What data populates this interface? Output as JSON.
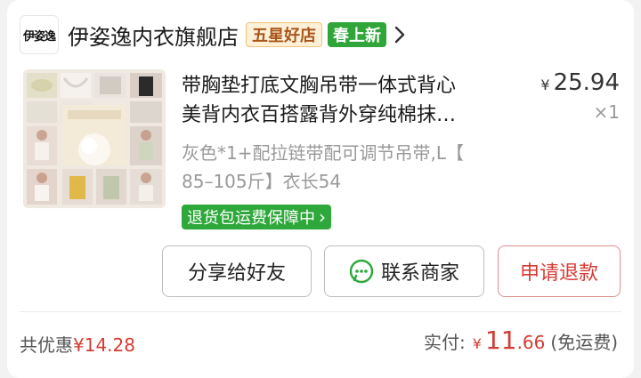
{
  "store": {
    "logo_text": "伊姿逸",
    "name": "伊姿逸内衣旗舰店",
    "badge_stars": "五星好店",
    "badge_spring": "春上新"
  },
  "product": {
    "title_line1": "带胸垫打底文胸吊带一体式背心",
    "title_line2": "美背内衣百搭露背外穿纯棉抹…",
    "price_symbol": "¥",
    "price": "25.94",
    "quantity": "×1",
    "variant_line1": "灰色*1+配拉链带配可调节吊带,L【",
    "variant_line2": "85–105斤】衣长54",
    "service_tag": "退货包运费保障中",
    "service_tag_arrow": "›"
  },
  "actions": {
    "share": "分享给好友",
    "contact": "联系商家",
    "refund": "申请退款"
  },
  "summary": {
    "discount_label": "共优惠",
    "discount_amount": "¥14.28",
    "paid_label": "实付:",
    "paid_symbol": "¥",
    "paid_int": "11",
    "paid_dec": ".66",
    "shipping_note": "(免运费)"
  },
  "colors": {
    "accent_red": "#d43b33",
    "accent_green": "#2ea83a"
  }
}
